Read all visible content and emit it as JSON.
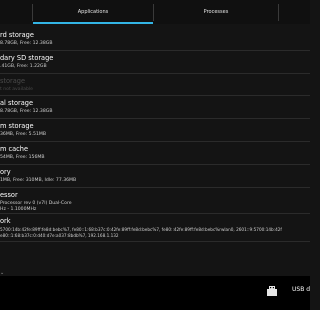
{
  "tabs": [
    {
      "label": "Applications",
      "selected": true
    },
    {
      "label": "Processes",
      "selected": false
    }
  ],
  "items": [
    {
      "title": "rd storage",
      "subtitle": "8.78GB, Free: 12.38GB"
    },
    {
      "title": "dary SD storage",
      "subtitle": ".41GB, Free: 1.22GB"
    },
    {
      "title": "storage",
      "subtitle": "t not available",
      "disabled": true
    },
    {
      "title": "al storage",
      "subtitle": "8.78GB, Free: 12.38GB"
    },
    {
      "title": "m storage",
      "subtitle": "36MB, Free: 5.51MB"
    },
    {
      "title": "m cache",
      "subtitle": "54MB, Free: 156MB"
    },
    {
      "title": "ory",
      "subtitle": "1MB, Free: 310MB, Idle: 77.36MB"
    },
    {
      "title": "essor",
      "subtitle": "Processor rev 0 (v7l) Dual-Core",
      "subtitle2": "Hz - 1.1000MHz"
    },
    {
      "title": "ork",
      "subtitle": "5700:14b:42fe:89ff:fe8d:bebc%7, fe80::1:68:b37c:0:42fe:89ff:fe8d:bebc%7, fe80::42fe:89ff:fe8d:bebc%rwlan0, 2601::9:5700:14b:42f",
      "subtitle2": "e80::1:68:b37c:0:d40:d7e:a037:8bdb%7, 192.168.1.132"
    }
  ],
  "bottom": {
    "usb_label": "USB d"
  },
  "colors": {
    "accent": "#33b5e5",
    "background": "#141414",
    "tab_bar": "#101010"
  }
}
